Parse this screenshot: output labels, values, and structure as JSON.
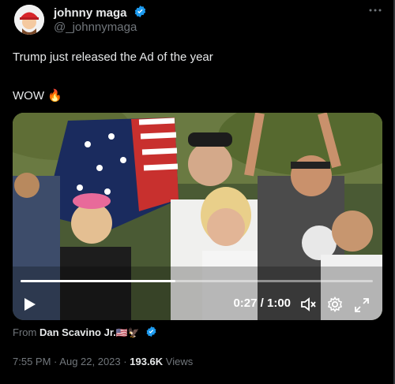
{
  "author": {
    "display_name": "johnny maga",
    "handle": "@_johnnymaga"
  },
  "tweet": {
    "line1": "Trump just released the Ad of the year",
    "line2": "WOW",
    "line2_emoji": "🔥"
  },
  "video": {
    "time": "0:27 / 1:00",
    "progress_fraction": 0.44
  },
  "source": {
    "prefix": "From",
    "name": "Dan Scavino Jr.",
    "emojis": "🇺🇸🦅"
  },
  "meta": {
    "time": "7:55 PM",
    "sep1": "·",
    "date": "Aug 22, 2023",
    "sep2": "·",
    "views_count": "193.6K",
    "views_label": "Views"
  },
  "colors": {
    "background": "#000000",
    "verified": "#1d9bf0",
    "secondary_text": "#71767b"
  }
}
